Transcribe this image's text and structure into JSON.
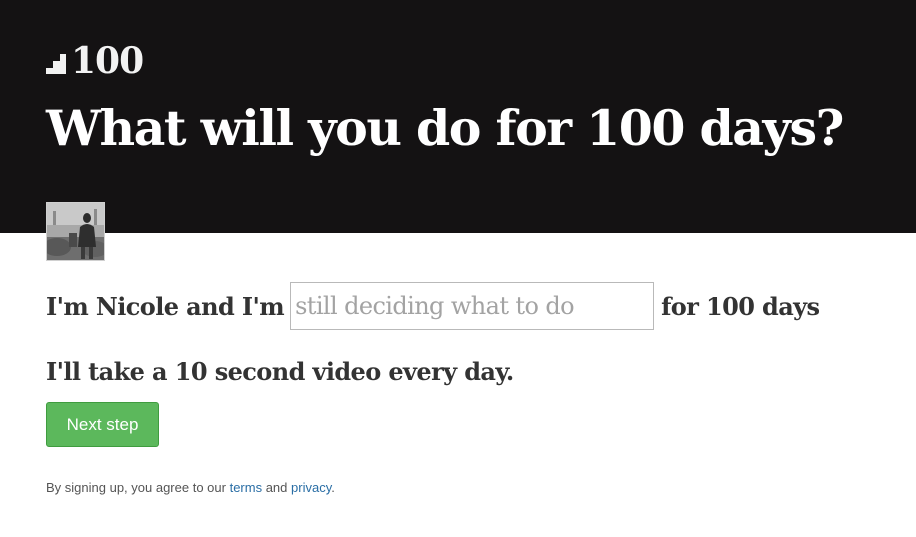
{
  "brand": {
    "logo_icon": "stairs-icon",
    "logo_text": "100"
  },
  "hero": {
    "headline": "What will you do for 100 days?",
    "background": "#141213"
  },
  "profile": {
    "avatar_icon": "user-photo-avatar"
  },
  "form": {
    "intro_prefix": "I'm Nicole and I'm",
    "goal_placeholder": "still deciding what to do",
    "goal_value": "",
    "intro_suffix": "for 100 days",
    "subline": "I'll take a 10 second video every day.",
    "next_label": "Next step",
    "next_color": "#5cb85c"
  },
  "legal": {
    "prefix": "By signing up, you agree to our",
    "terms_label": "terms",
    "and_text": "and",
    "privacy_label": "privacy",
    "suffix": ".",
    "link_color": "#2a6ea5"
  }
}
